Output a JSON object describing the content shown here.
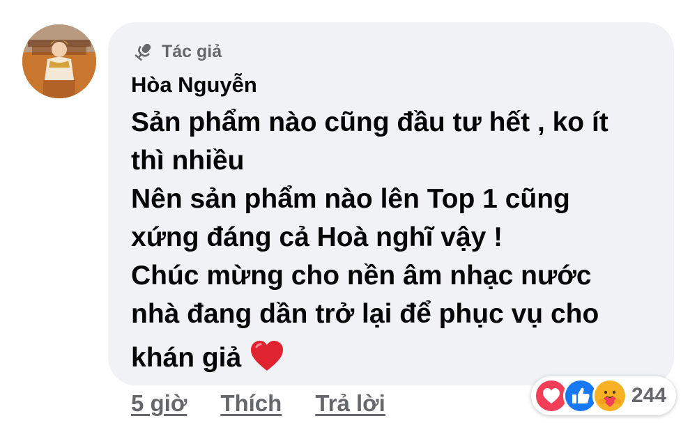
{
  "badge": {
    "label": "Tác giả",
    "icon": "microphone-icon"
  },
  "comment": {
    "author": "Hòa Nguyễn",
    "lines": [
      "Sản phẩm nào cũng đầu tư hết , ko ít",
      "thì nhiều",
      "Nên sản phẩm nào lên Top 1 cũng",
      "xứng đáng cả Hoà nghĩ vậy !",
      "Chúc mừng cho nền âm nhạc nước",
      "nhà đang dần trở lại để phục vụ cho",
      "khán giả"
    ],
    "emoji": "red-heart-icon"
  },
  "actions": {
    "time": "5 giờ",
    "like": "Thích",
    "reply": "Trả lời"
  },
  "reactions": {
    "icons": [
      "love-reaction-icon",
      "like-reaction-icon",
      "care-reaction-icon"
    ],
    "count": "244"
  },
  "colors": {
    "bubble": "#f0f2f5",
    "text": "#050505",
    "muted": "#65676b",
    "love": "#f33e58",
    "like": "#1877f2",
    "care": "#f7b125"
  }
}
